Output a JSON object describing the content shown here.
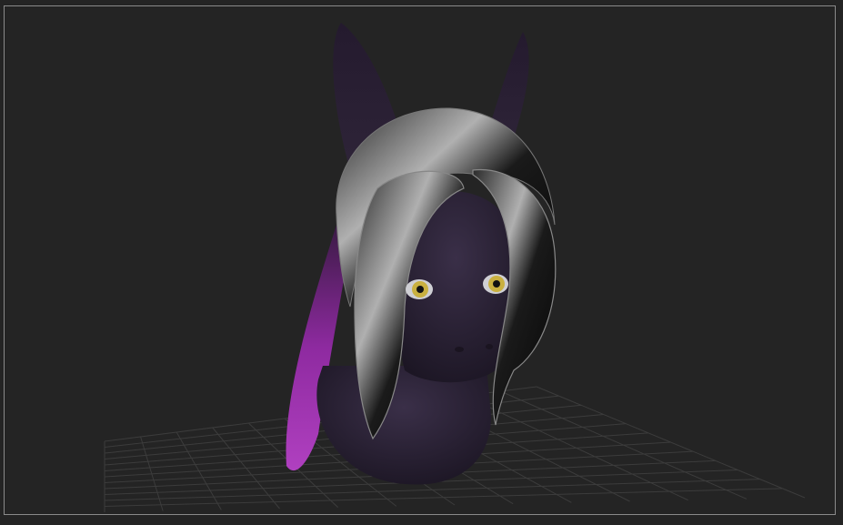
{
  "viewport": {
    "background_color": "#242424",
    "frame_color": "#8a8a8a",
    "grid_color": "#3c3c3c"
  },
  "model": {
    "skin_color": "#2a2135",
    "hair_color": "#101010",
    "hair_highlight_color": "#9a9a9a",
    "inner_ear_color": "#8a2a9a",
    "eye_color": "#c9b040"
  }
}
